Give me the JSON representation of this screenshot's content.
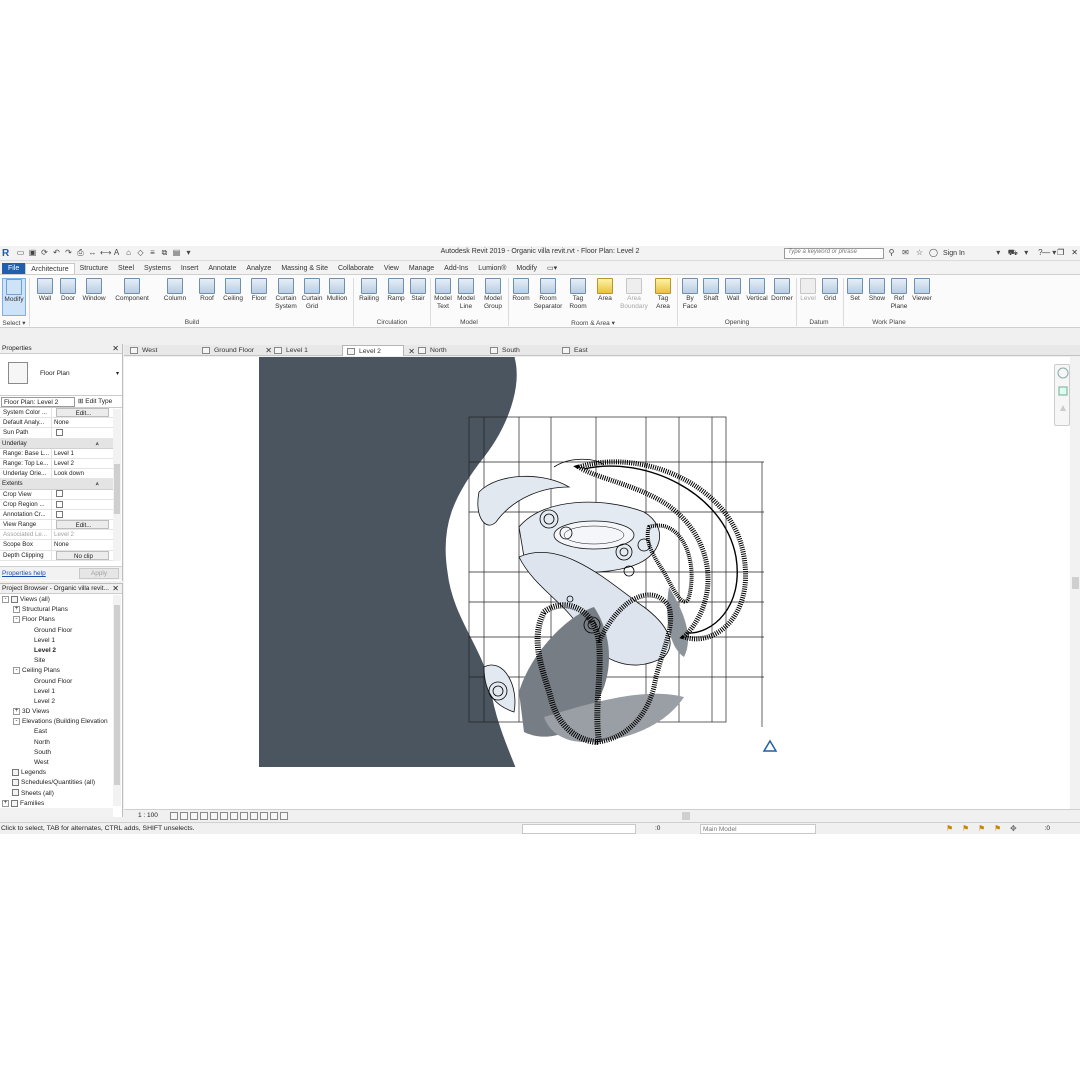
{
  "titlebar": {
    "logo": "R",
    "title": "Autodesk Revit 2019 - Organic villa revit.rvt - Floor Plan: Level 2",
    "search_placeholder": "Type a keyword or phrase",
    "sign_in": "Sign In",
    "help": "?"
  },
  "ribbon_tabs": [
    "File",
    "Architecture",
    "Structure",
    "Steel",
    "Systems",
    "Insert",
    "Annotate",
    "Analyze",
    "Massing & Site",
    "Collaborate",
    "View",
    "Manage",
    "Add-Ins",
    "Lumion®",
    "Modify"
  ],
  "ribbon": {
    "select": {
      "modify": "Modify",
      "label": "Select ▾"
    },
    "build": {
      "label": "Build",
      "items": [
        "Wall",
        "Door",
        "Window",
        "Component",
        "Column",
        "Roof",
        "Ceiling",
        "Floor",
        "Curtain\nSystem",
        "Curtain\nGrid",
        "Mullion"
      ]
    },
    "circulation": {
      "label": "Circulation",
      "items": [
        "Railing",
        "Ramp",
        "Stair"
      ]
    },
    "model": {
      "label": "Model",
      "items": [
        "Model\nText",
        "Model\nLine",
        "Model\nGroup"
      ]
    },
    "room_area": {
      "label": "Room & Area ▾",
      "items": [
        "Room",
        "Room\nSeparator",
        "Tag\nRoom",
        "Area",
        "Area\nBoundary",
        "Tag\nArea"
      ]
    },
    "opening": {
      "label": "Opening",
      "items": [
        "By\nFace",
        "Shaft",
        "Wall",
        "Vertical",
        "Dormer"
      ]
    },
    "datum": {
      "label": "Datum",
      "items": [
        "Level",
        "Grid"
      ]
    },
    "work_plane": {
      "label": "Work Plane",
      "items": [
        "Set",
        "Show",
        "Ref\nPlane",
        "Viewer"
      ]
    }
  },
  "properties": {
    "title": "Properties",
    "type_name": "Floor Plan",
    "instance": "Floor Plan: Level 2",
    "edit_type": "Edit Type",
    "rows_a": [
      {
        "k": "System Color ...",
        "v": "Edit...",
        "btn": true
      },
      {
        "k": "Default Analy...",
        "v": "None"
      },
      {
        "k": "Sun Path",
        "v": "",
        "cb": true
      }
    ],
    "group_underlay": "Underlay",
    "rows_b": [
      {
        "k": "Range: Base L...",
        "v": "Level 1"
      },
      {
        "k": "Range: Top Le...",
        "v": "Level 2"
      },
      {
        "k": "Underlay Orie...",
        "v": "Look down"
      }
    ],
    "group_extents": "Extents",
    "rows_c": [
      {
        "k": "Crop View",
        "v": "",
        "cb": true
      },
      {
        "k": "Crop Region ...",
        "v": "",
        "cb": true
      },
      {
        "k": "Annotation Cr...",
        "v": "",
        "cb": true
      },
      {
        "k": "View Range",
        "v": "Edit...",
        "btn": true
      },
      {
        "k": "Associated Le...",
        "v": "Level 2",
        "grey": true
      },
      {
        "k": "Scope Box",
        "v": "None"
      },
      {
        "k": "Depth Clipping",
        "v": "No clip",
        "btn": true
      }
    ],
    "help": "Properties help",
    "apply": "Apply"
  },
  "browser": {
    "title": "Project Browser - Organic villa revit...",
    "items": [
      {
        "t": "Views (all)",
        "lvl": 0,
        "exp": "-",
        "ico": true
      },
      {
        "t": "Structural Plans",
        "lvl": 1,
        "exp": "+"
      },
      {
        "t": "Floor Plans",
        "lvl": 1,
        "exp": "-"
      },
      {
        "t": "Ground Floor",
        "lvl": 2
      },
      {
        "t": "Level 1",
        "lvl": 2
      },
      {
        "t": "Level 2",
        "lvl": 2,
        "bold": true
      },
      {
        "t": "Site",
        "lvl": 2
      },
      {
        "t": "Ceiling Plans",
        "lvl": 1,
        "exp": "-"
      },
      {
        "t": "Ground Floor",
        "lvl": 2
      },
      {
        "t": "Level 1",
        "lvl": 2
      },
      {
        "t": "Level 2",
        "lvl": 2
      },
      {
        "t": "3D Views",
        "lvl": 1,
        "exp": "+"
      },
      {
        "t": "Elevations (Building Elevation",
        "lvl": 1,
        "exp": "-"
      },
      {
        "t": "East",
        "lvl": 2
      },
      {
        "t": "North",
        "lvl": 2
      },
      {
        "t": "South",
        "lvl": 2
      },
      {
        "t": "West",
        "lvl": 2
      },
      {
        "t": "Legends",
        "lvl": 0,
        "ico": true
      },
      {
        "t": "Schedules/Quantities (all)",
        "lvl": 0,
        "ico": true
      },
      {
        "t": "Sheets (all)",
        "lvl": 0,
        "ico": true
      },
      {
        "t": "Families",
        "lvl": 0,
        "exp": "+",
        "ico": true
      }
    ]
  },
  "view_tabs": [
    {
      "label": "West",
      "active": false
    },
    {
      "label": "Ground Floor",
      "active": false,
      "close": true
    },
    {
      "label": "Level 1",
      "active": false
    },
    {
      "label": "Level 2",
      "active": true,
      "close": true
    },
    {
      "label": "North",
      "active": false
    },
    {
      "label": "South",
      "active": false
    },
    {
      "label": "East",
      "active": false
    }
  ],
  "view_control": {
    "scale": "1 : 100"
  },
  "status": {
    "message": "Click to select, TAB for alternates, CTRL adds, SHIFT unselects.",
    "zero": ":0",
    "model": "Main Model",
    "filter": ":0"
  },
  "colors": {
    "site_gray": "#4a5560",
    "accent": "#1f5fae",
    "highlight": "#cfe3f8"
  }
}
